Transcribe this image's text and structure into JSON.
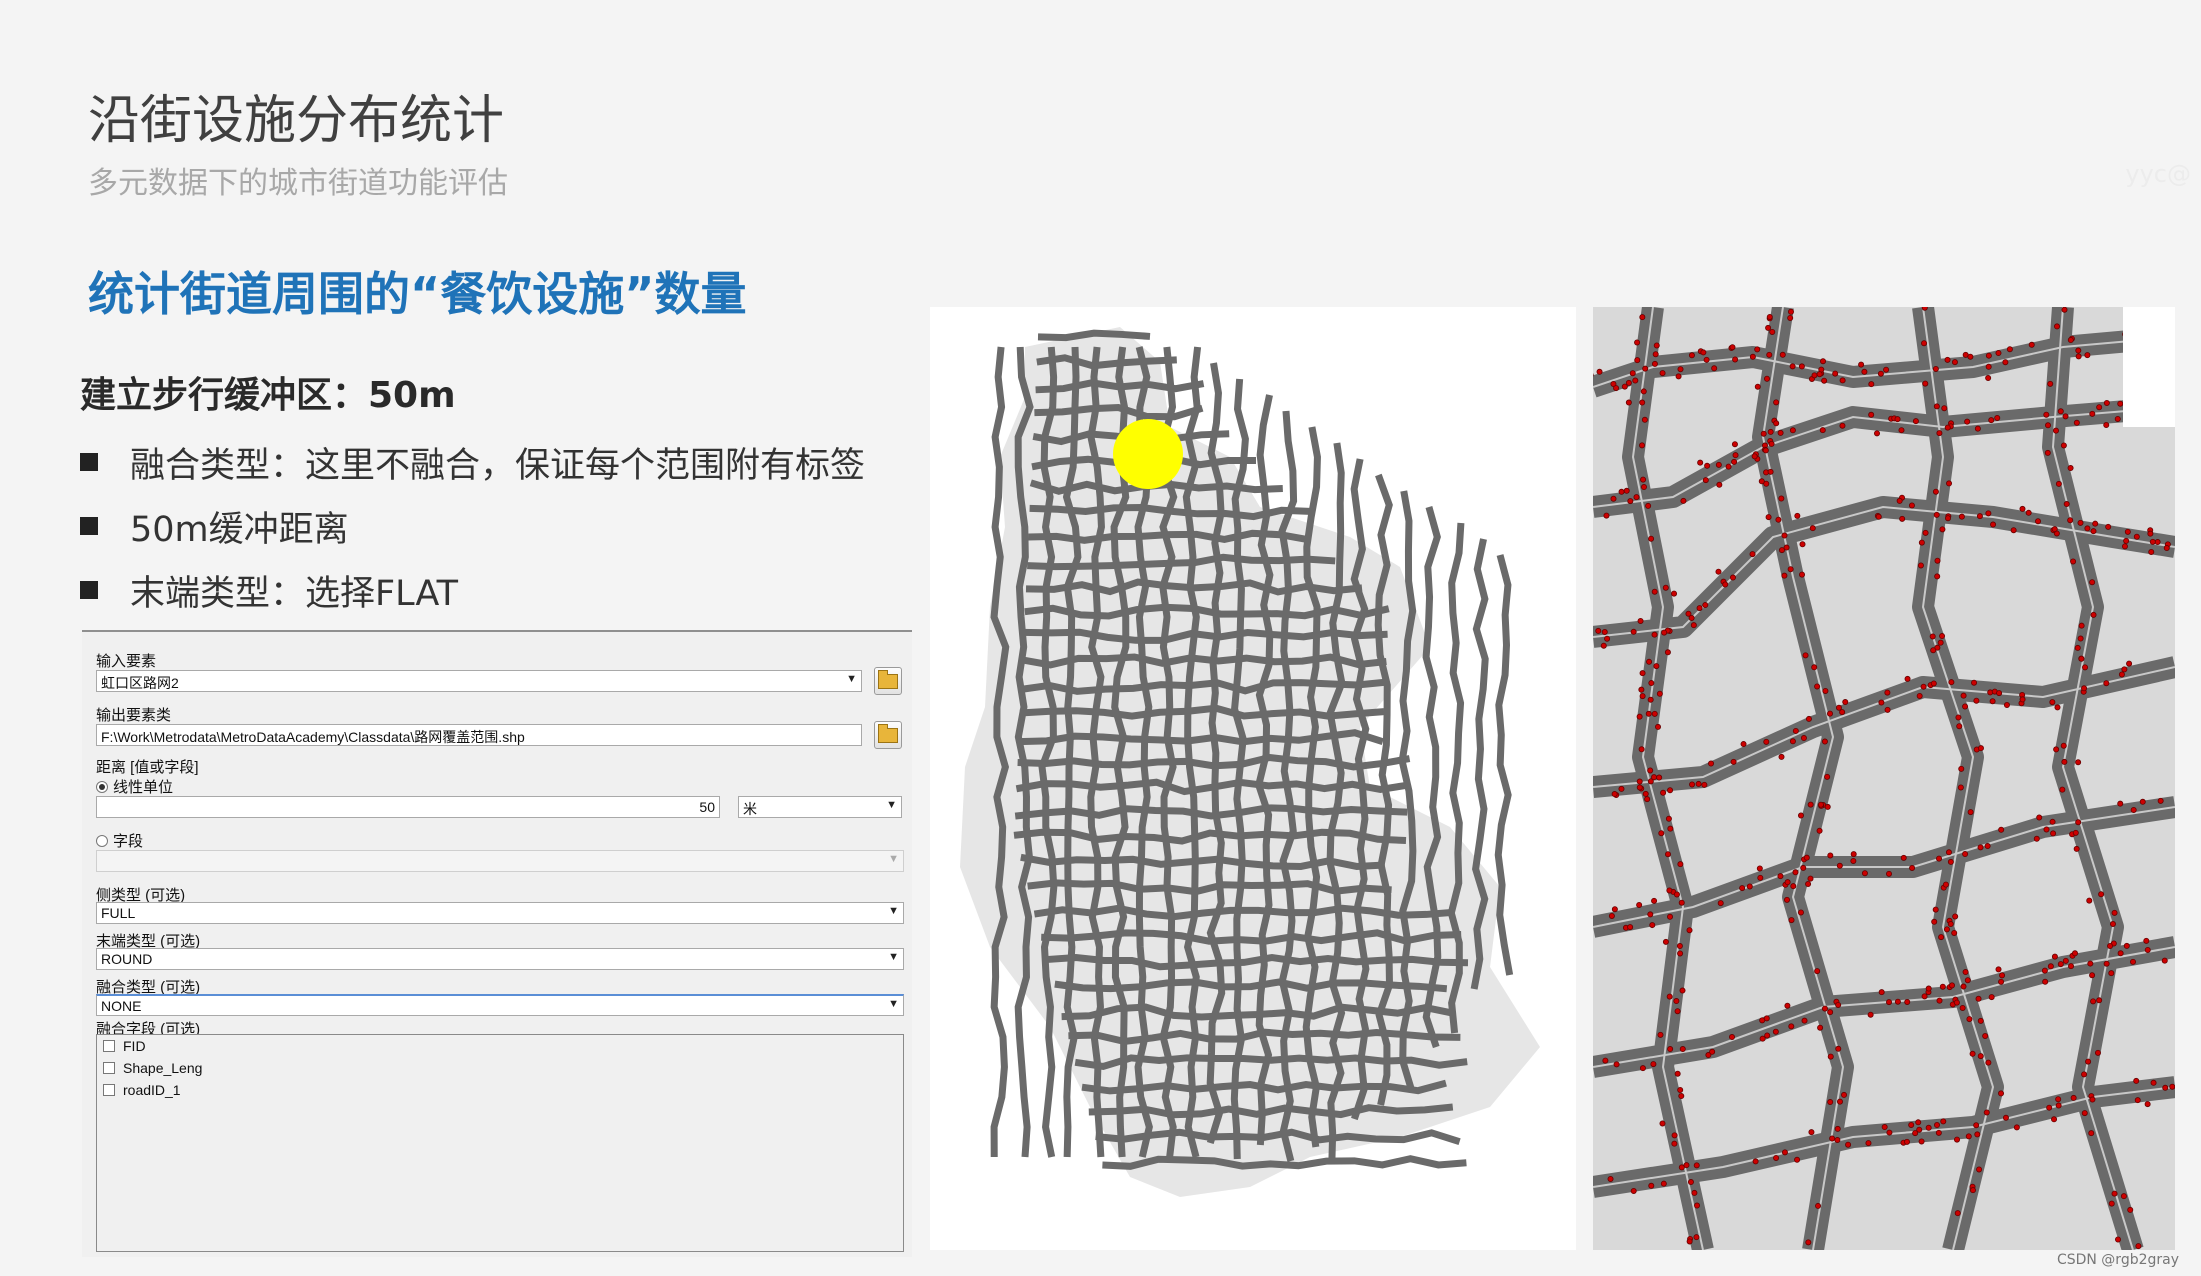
{
  "slide": {
    "title": "沿街设施分布统计",
    "subtitle": "多元数据下的城市街道功能评估",
    "watermark": "yyc@",
    "section_heading": "统计街道周围的“餐饮设施”数量",
    "buffer_heading": "建立步行缓冲区：50m",
    "bullets": [
      "融合类型：这里不融合，保证每个范围附有标签",
      "50m缓冲距离",
      "末端类型：选择FLAT"
    ],
    "credit": "CSDN @rgb2gray"
  },
  "dialog": {
    "input_label": "输入要素",
    "input_value": "虹口区路网2",
    "output_label": "输出要素类",
    "output_value": "F:\\Work\\Metrodata\\MetroDataAcademy\\Classdata\\路网覆盖范围.shp",
    "distance_label": "距离 [值或字段]",
    "linear_unit_label": "线性单位",
    "distance_value": "50",
    "unit_value": "米",
    "field_label": "字段",
    "field_value": "",
    "side_type_label": "侧类型 (可选)",
    "side_type_value": "FULL",
    "end_type_label": "末端类型 (可选)",
    "end_type_value": "ROUND",
    "dissolve_type_label": "融合类型 (可选)",
    "dissolve_type_value": "NONE",
    "dissolve_field_label": "融合字段 (可选)",
    "dissolve_fields": [
      "FID",
      "Shape_Leng",
      "roadID_1"
    ]
  },
  "maps": {
    "highlight_color": "#ffff00",
    "road_color": "#6a6a6a",
    "district_color": "#e6e6e6",
    "poi_color": "#cc0000"
  }
}
